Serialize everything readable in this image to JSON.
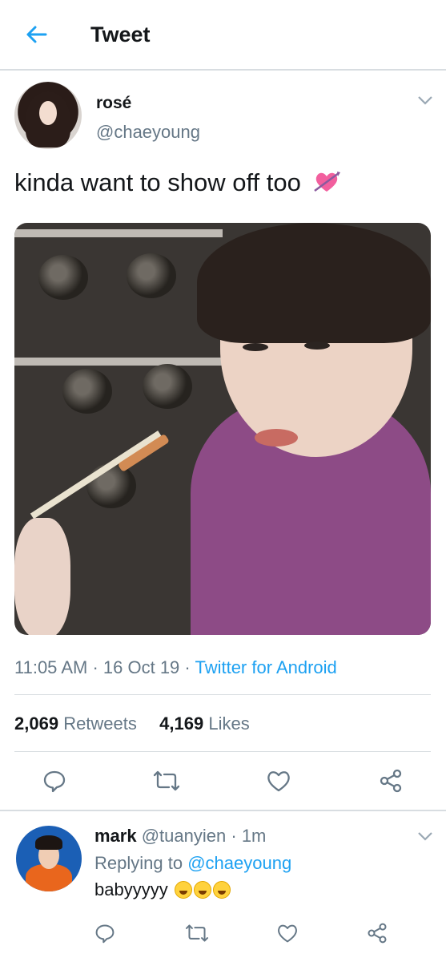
{
  "header": {
    "title": "Tweet"
  },
  "tweet": {
    "author_name": "rosé",
    "author_handle": "@chaeyoung",
    "text": "kinda want to show off too",
    "time": "11:05 AM",
    "sep1": "·",
    "date": "16 Oct 19",
    "sep2": "·",
    "source": "Twitter for Android",
    "retweets_count": "2,069",
    "retweets_label": "Retweets",
    "likes_count": "4,169",
    "likes_label": "Likes",
    "text_emoji": "heart-with-arrow-icon"
  },
  "reply": {
    "author_name": "mark",
    "author_handle": "@tuanyien",
    "sep": "·",
    "time": "1m",
    "replying_label": "Replying to",
    "replying_to": "@chaeyoung",
    "text": "babyyyyy",
    "emojis": [
      "laughing-face-icon",
      "laughing-face-icon",
      "laughing-face-icon"
    ]
  },
  "colors": {
    "accent": "#1da1f2",
    "secondary_text": "#657786",
    "primary_text": "#14171a",
    "divider": "#d8dde1"
  }
}
